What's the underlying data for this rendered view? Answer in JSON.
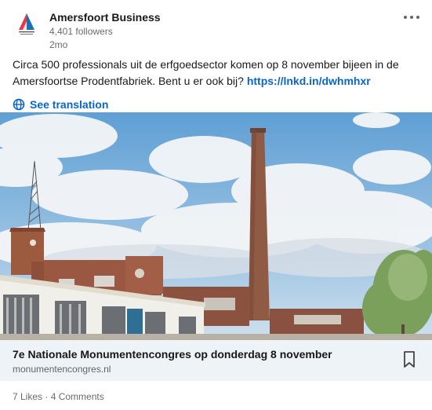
{
  "post": {
    "author": {
      "name": "Amersfoort Business",
      "followers": "4,401 followers",
      "timestamp": "2mo",
      "logo_text": "Amersfoort Business"
    },
    "more_icon": "more-horizontal-icon",
    "text": "Circa 500 professionals uit de erfgoedsector komen op 8 november bijeen in de Amersfoortse Prodentfabriek. Bent u er ook bij? ",
    "link_text": "https://lnkd.in/dwhmhxr",
    "translation_label": "See translation",
    "translation_icon": "globe-icon"
  },
  "preview": {
    "title": "7e Nationale Monumentencongres op donderdag 8 november",
    "domain": "monumentencongres.nl",
    "bookmark_icon": "bookmark-icon"
  },
  "social": {
    "likes": "7 Likes",
    "separator": " · ",
    "comments": "4 Comments"
  },
  "colors": {
    "link": "#0a66c2",
    "preview_bg": "#eef3f8",
    "logo_red": "#e63946",
    "logo_blue": "#1d6fb8"
  }
}
